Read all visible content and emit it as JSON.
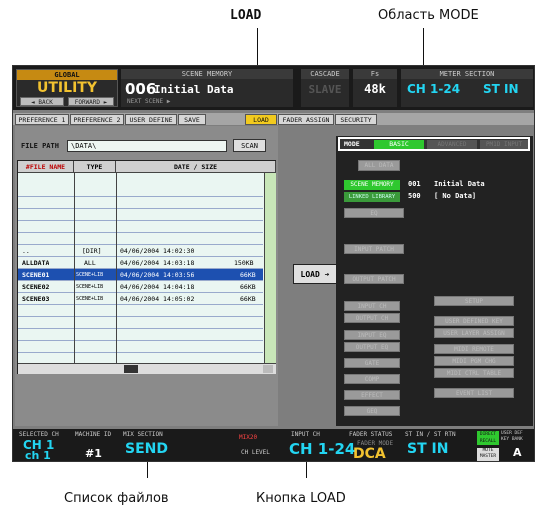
{
  "callouts": {
    "load": "LOAD",
    "mode_area": "Область MODE",
    "file_list": "Список файлов",
    "load_button": "Кнопка LOAD"
  },
  "header": {
    "global_label": "GLOBAL",
    "utility": "UTILITY",
    "back": "◄ BACK",
    "forward": "FORWARD ►",
    "scene_memory_label": "SCENE MEMORY",
    "scene_number": "006",
    "scene_title": "Initial Data",
    "next_scene": "NEXT SCENE ▶",
    "cascade_label": "CASCADE",
    "cascade_value": "SLAVE",
    "fs_label": "Fs",
    "fs_value": "48k",
    "meter_label": "METER SECTION",
    "meter_ch": "CH 1-24",
    "meter_st": "ST IN"
  },
  "tabs": [
    "PREFERENCE 1",
    "PREFERENCE 2",
    "USER DEFINE",
    "SAVE",
    "LOAD",
    "FADER ASSIGN",
    "SECURITY"
  ],
  "selected_tab": "LOAD",
  "file_path": {
    "label": "FILE PATH",
    "value": "\\DATA\\",
    "scan": "SCAN"
  },
  "table": {
    "headers": [
      "#FILE NAME",
      "TYPE",
      "DATE / SIZE"
    ],
    "rows": [
      {
        "name": "..",
        "type": "[DIR]",
        "date": "04/06/2004 14:02:30",
        "size": ""
      },
      {
        "name": "ALLDATA",
        "type": "ALL",
        "date": "04/06/2004 14:03:18",
        "size": "150KB"
      },
      {
        "name": "SCENE01",
        "type": "SCENE+LIB",
        "date": "04/06/2004 14:03:56",
        "size": "66KB"
      },
      {
        "name": "SCENE02",
        "type": "SCENE+LIB",
        "date": "04/06/2004 14:04:18",
        "size": "66KB"
      },
      {
        "name": "SCENE03",
        "type": "SCENE+LIB",
        "date": "04/06/2004 14:05:02",
        "size": "66KB"
      }
    ]
  },
  "load_button": "LOAD ➔",
  "mode": {
    "label": "MODE",
    "options": [
      "BASIC",
      "ADVANCED",
      "PM1D INPUT"
    ],
    "selected": "BASIC"
  },
  "right": {
    "all_data": "ALL DATA",
    "scene_memory": "SCENE MEMORY",
    "scene_num": "001",
    "scene_title": "Initial Data",
    "linked_library": "LINKED LIBRARY",
    "library_num": "500",
    "library_title": "[  No Data]",
    "eq": "EQ",
    "input_patch": "INPUT PATCH",
    "output_patch": "OUTPUT PATCH",
    "buttons_left": [
      "INPUT CH",
      "OUTPUT CH",
      "INPUT EQ",
      "OUTPUT EQ",
      "GATE",
      "COMP",
      "EFFECT",
      "GEQ"
    ],
    "buttons_right": [
      "SETUP",
      "USER DEFINED KEY",
      "USER LAYER ASSIGN",
      "MIDI REMOTE",
      "MIDI PGM CHG",
      "MIDI CTRL TABLE",
      "EVENT LIST"
    ]
  },
  "bottom": {
    "selected_ch_label": "SELECTED CH",
    "machine_id_label": "MACHINE ID",
    "ch_top": "CH 1",
    "ch_bot": "ch 1",
    "machine": "#1",
    "mix_section": "MIX SECTION",
    "send": "SEND",
    "mix_value": "MIX20",
    "ch_level": "CH LEVEL",
    "input_label": "INPUT CH",
    "input_value": "CH 1-24",
    "fader_status": "FADER STATUS",
    "fader_mode": "FADER MODE",
    "dca": "DCA",
    "st_label": "ST IN / ST RTN",
    "st_value": "ST IN",
    "direct_recall": "DIRECT RECALL",
    "user_def": "USER DEF KEY BANK",
    "mute_master": "MUTE MASTER",
    "bank": "A"
  }
}
